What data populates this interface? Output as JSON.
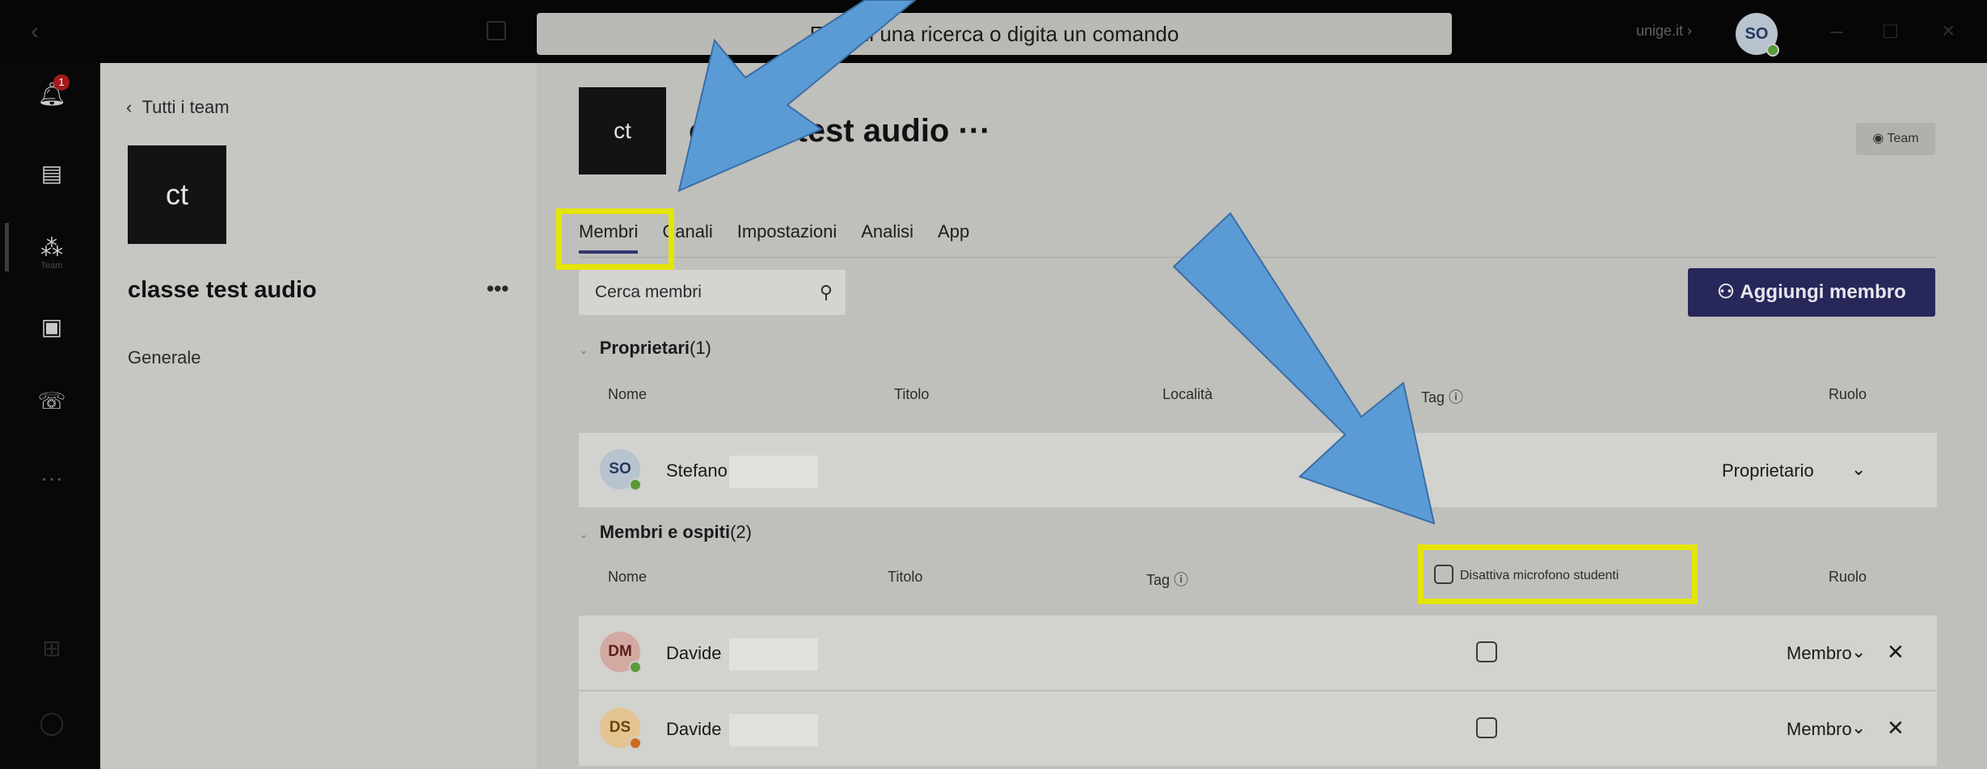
{
  "titlebar": {
    "search_placeholder": "Esegui una ricerca o digita un comando",
    "org": "unige.it",
    "user_initials": "SO"
  },
  "rail": {
    "notification_count": "1",
    "teams_label": "Team"
  },
  "team_pane": {
    "back_label": "Tutti i team",
    "team_initials": "ct",
    "team_name": "classe test audio",
    "more": "•••",
    "channel": "Generale"
  },
  "main": {
    "team_initials": "ct",
    "title": "classe test audio ···",
    "team_button": "Team",
    "tabs": [
      "Membri",
      "Canali",
      "Impostazioni",
      "Analisi",
      "App"
    ],
    "search_placeholder": "Cerca membri",
    "add_member": "Aggiungi membro",
    "owners": {
      "heading": "Proprietari",
      "count": "(1)",
      "columns": [
        "Nome",
        "Titolo",
        "Località",
        "Tag",
        "Ruolo"
      ],
      "rows": [
        {
          "initials": "SO",
          "name": "Stefano",
          "role": "Proprietario"
        }
      ]
    },
    "members": {
      "heading": "Membri e ospiti",
      "count": "(2)",
      "columns": [
        "Nome",
        "Titolo",
        "Tag",
        "Disattiva microfono studenti",
        "Ruolo"
      ],
      "rows": [
        {
          "initials": "DM",
          "name": "Davide",
          "role": "Membro"
        },
        {
          "initials": "DS",
          "name": "Davide",
          "role": "Membro"
        }
      ]
    }
  },
  "colors": {
    "accent": "#27275a",
    "highlight": "#e5e500",
    "arrow": "#5b9bd5"
  }
}
